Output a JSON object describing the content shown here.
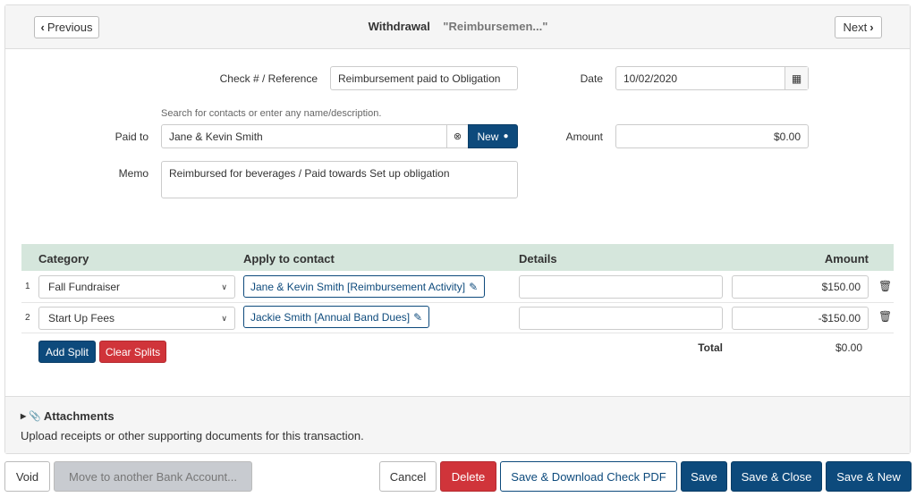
{
  "header": {
    "prev_label": "Previous",
    "next_label": "Next",
    "title": "Withdrawal",
    "subtitle": "\"Reimbursemen...\""
  },
  "form": {
    "check_label": "Check # / Reference",
    "check_value": "Reimbursement paid to Obligation",
    "date_label": "Date",
    "date_value": "10/02/2020",
    "paid_hint": "Search for contacts or enter any name/description.",
    "paid_label": "Paid to",
    "paid_value": "Jane & Kevin Smith",
    "new_label": "New",
    "amount_label": "Amount",
    "amount_value": "$0.00",
    "memo_label": "Memo",
    "memo_value": "Reimbursed for beverages / Paid towards Set up obligation"
  },
  "splits": {
    "headers": {
      "category": "Category",
      "contact": "Apply to contact",
      "details": "Details",
      "amount": "Amount"
    },
    "rows": [
      {
        "num": "1",
        "category": "Fall Fundraiser",
        "contact": "Jane & Kevin Smith [Reimbursement Activity]",
        "details": "",
        "amount": "$150.00"
      },
      {
        "num": "2",
        "category": "Start Up Fees",
        "contact": "Jackie Smith [Annual Band Dues]",
        "details": "",
        "amount": "-$150.00"
      }
    ],
    "add_label": "Add Split",
    "clear_label": "Clear Splits",
    "total_label": "Total",
    "total_value": "$0.00"
  },
  "attachments": {
    "title": "Attachments",
    "description": "Upload receipts or other supporting documents for this transaction."
  },
  "footer": {
    "void": "Void",
    "move": "Move to another Bank Account...",
    "cancel": "Cancel",
    "delete": "Delete",
    "save_pdf": "Save & Download Check PDF",
    "save": "Save",
    "save_close": "Save & Close",
    "save_new": "Save & New"
  },
  "colors": {
    "primary": "#0d4a7c",
    "danger": "#d0343a",
    "table_header": "#d5e6dc"
  }
}
